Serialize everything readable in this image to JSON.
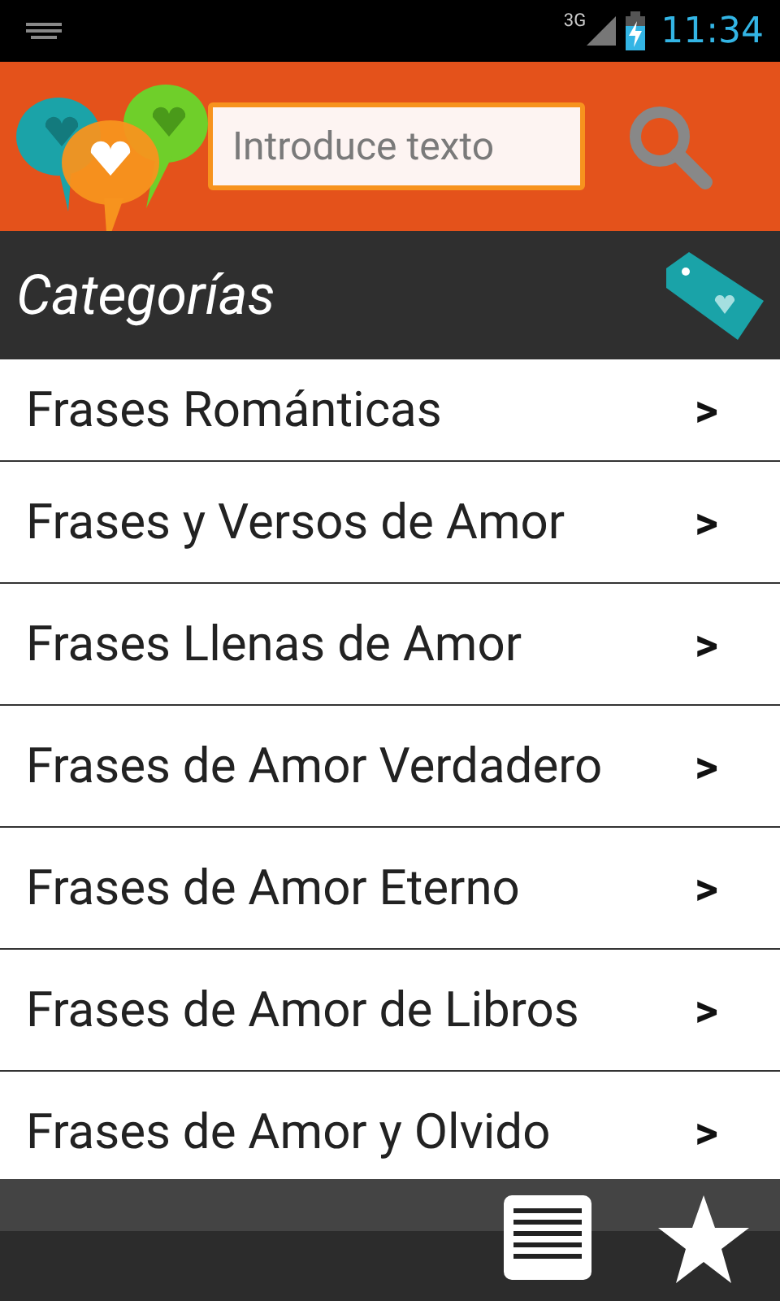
{
  "status_bar": {
    "network": "3G",
    "time": "11:34"
  },
  "search": {
    "placeholder": "Introduce texto"
  },
  "section": {
    "title": "Categorías"
  },
  "categories": [
    {
      "label": "Frases Románticas",
      "arrow": ">"
    },
    {
      "label": "Frases y Versos de Amor",
      "arrow": ">"
    },
    {
      "label": "Frases Llenas de Amor",
      "arrow": ">"
    },
    {
      "label": "Frases de Amor Verdadero",
      "arrow": ">"
    },
    {
      "label": "Frases de Amor Eterno",
      "arrow": ">"
    },
    {
      "label": "Frases de Amor de Libros",
      "arrow": ">"
    },
    {
      "label": "Frases de Amor y Olvido",
      "arrow": ">"
    }
  ]
}
